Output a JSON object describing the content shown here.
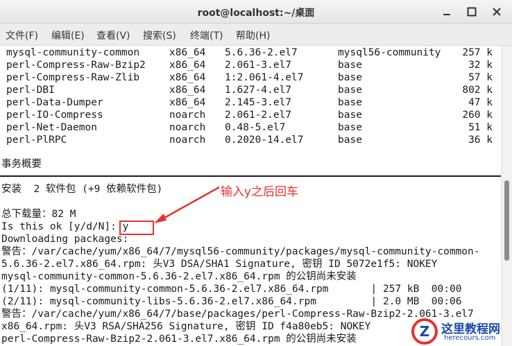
{
  "window": {
    "title": "root@localhost:~/桌面"
  },
  "menu": [
    "文件(F)",
    "编辑(E)",
    "查看(V)",
    "搜索(S)",
    "终端(T)",
    "帮助(H)"
  ],
  "packages": [
    {
      "name": "mysql-community-common",
      "arch": "x86_64",
      "version": "5.6.36-2.el7",
      "repo": "mysql56-community",
      "size": "257 k"
    },
    {
      "name": "perl-Compress-Raw-Bzip2",
      "arch": "x86_64",
      "version": "2.061-3.el7",
      "repo": "base",
      "size": "32 k"
    },
    {
      "name": "perl-Compress-Raw-Zlib",
      "arch": "x86_64",
      "version": "1:2.061-4.el7",
      "repo": "base",
      "size": "57 k"
    },
    {
      "name": "perl-DBI",
      "arch": "x86_64",
      "version": "1.627-4.el7",
      "repo": "base",
      "size": "802 k"
    },
    {
      "name": "perl-Data-Dumper",
      "arch": "x86_64",
      "version": "2.145-3.el7",
      "repo": "base",
      "size": "47 k"
    },
    {
      "name": "perl-IO-Compress",
      "arch": "noarch",
      "version": "2.061-2.el7",
      "repo": "base",
      "size": "260 k"
    },
    {
      "name": "perl-Net-Daemon",
      "arch": "noarch",
      "version": "0.48-5.el7",
      "repo": "base",
      "size": "51 k"
    },
    {
      "name": "perl-PlRPC",
      "arch": "noarch",
      "version": "0.2020-14.el7",
      "repo": "base",
      "size": "36 k"
    }
  ],
  "summary": {
    "heading": "事务概要",
    "install": "安装  2 软件包 (+9 依赖软件包)",
    "total": "总下载量：82 M",
    "prompt": "Is this ok [y/d/N]: ",
    "answer": "y"
  },
  "log": [
    "Downloading packages:",
    "警告：/var/cache/yum/x86_64/7/mysql56-community/packages/mysql-community-common-",
    "5.6.36-2.el7.x86_64.rpm: 头V3 DSA/SHA1 Signature, 密钥 ID 5072e1f5: NOKEY",
    "mysql-community-common-5.6.36-2.el7.x86_64.rpm 的公钥尚未安装",
    "(1/11): mysql-community-common-5.6.36-2.el7.x86_64.rpm       | 257 kB  00:00",
    "(2/11): mysql-community-libs-5.6.36-2.el7.x86_64.rpm         | 2.0 MB  00:06",
    "警告：/var/cache/yum/x86_64/7/base/packages/perl-Compress-Raw-Bzip2-2.061-3.el7",
    "x86_64.rpm: 头V3 RSA/SHA256 Signature, 密钥 ID f4a80eb5: NOKEY",
    "perl-Compress-Raw-Bzip2-2.061-3.el7.x86_64.rpm 的公钥尚未安装"
  ],
  "annotation": "输入y之后回车",
  "watermark": {
    "title": "这里教程网",
    "url": "herecours.com",
    "accent": "#e8302b",
    "brand": "#1f4aa8"
  }
}
